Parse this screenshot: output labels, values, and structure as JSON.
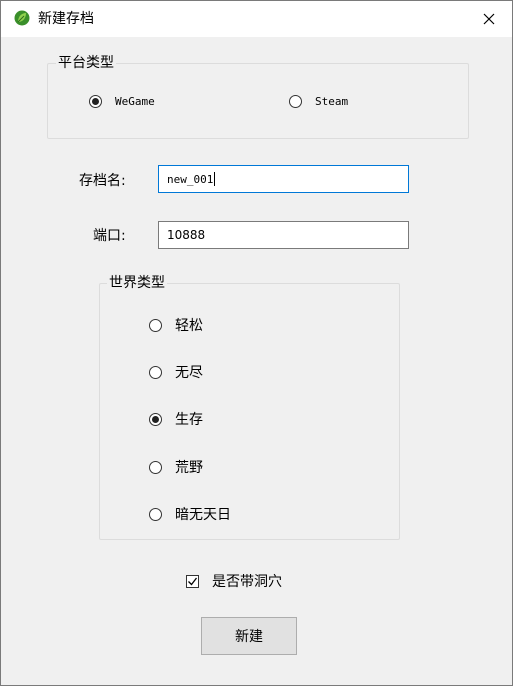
{
  "window": {
    "title": "新建存档",
    "close_glyph": "✕",
    "icon": "leaf-icon"
  },
  "platform": {
    "legend": "平台类型",
    "options": [
      {
        "label": "WeGame",
        "checked": true
      },
      {
        "label": "Steam",
        "checked": false
      }
    ]
  },
  "save_name": {
    "label": "存档名:",
    "value": "new_001"
  },
  "port": {
    "label": "端口:",
    "value": "10888"
  },
  "world": {
    "legend": "世界类型",
    "options": [
      {
        "label": "轻松",
        "checked": false
      },
      {
        "label": "无尽",
        "checked": false
      },
      {
        "label": "生存",
        "checked": true
      },
      {
        "label": "荒野",
        "checked": false
      },
      {
        "label": "暗无天日",
        "checked": false
      }
    ]
  },
  "caves": {
    "label": "是否带洞穴",
    "checked": true
  },
  "create_button": {
    "label": "新建"
  },
  "colors": {
    "focus_border": "#0078d7",
    "button_bg": "#e1e1e1",
    "window_bg": "#f0f0f0"
  }
}
